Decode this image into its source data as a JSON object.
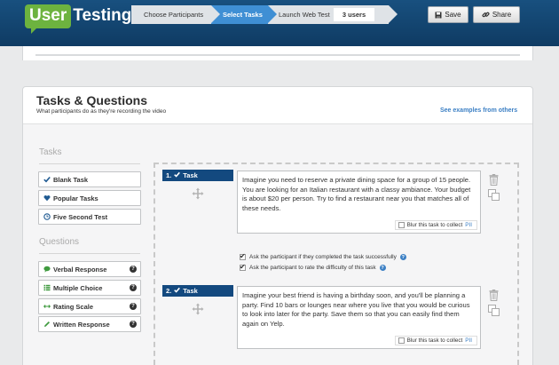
{
  "header": {
    "logo_user": "User",
    "logo_testing": "Testing",
    "logo_reg": "®",
    "steps": [
      "Choose Participants",
      "Select Tasks",
      "Launch Web Test"
    ],
    "active_step": "Select Tasks",
    "users_count": "3 users",
    "save_label": "Save",
    "share_label": "Share"
  },
  "card": {
    "title": "Tasks & Questions",
    "subtitle": "What participants do as they're recording the video",
    "examples_link": "See examples from others"
  },
  "sidebar": {
    "tasks_title": "Tasks",
    "task_items": [
      {
        "label": "Blank Task",
        "icon": "checkmark-icon"
      },
      {
        "label": "Popular Tasks",
        "icon": "heart-icon"
      },
      {
        "label": "Five Second Test",
        "icon": "clock-icon"
      }
    ],
    "questions_title": "Questions",
    "question_items": [
      {
        "label": "Verbal Response",
        "icon": "speech-bubble-icon"
      },
      {
        "label": "Multiple Choice",
        "icon": "list-icon"
      },
      {
        "label": "Rating Scale",
        "icon": "double-arrow-icon"
      },
      {
        "label": "Written Response",
        "icon": "pencil-icon"
      }
    ]
  },
  "tasks": [
    {
      "number": "1.",
      "type": "Task",
      "text": "Imagine you need to reserve a private dining space for a group of 15 people. You are looking for an Italian restaurant with a classy ambiance. Your budget is about $20 per person. Try to find a restaurant near you that matches all of these needs.",
      "blur_label": "Blur this task to collect",
      "blur_link": "PII"
    },
    {
      "number": "2.",
      "type": "Task",
      "text": "Imagine your best friend is having a birthday soon, and you'll be planning a party. Find 10 bars or lounges near where you live that you would be curious to look into later for the party. Save them so that you can easily find them again on Yelp.",
      "blur_label": "Blur this task to collect",
      "blur_link": "PII"
    }
  ],
  "options": [
    {
      "label": "Ask the participant if they completed the task successfully",
      "checked": true
    },
    {
      "label": "Ask the participant to rate the difficulty of this task",
      "checked": true
    }
  ],
  "colors": {
    "header_bg": "#13497f",
    "active_step": "#3f8fd4",
    "logo_green": "#6db33f",
    "link_blue": "#3b7fc4"
  }
}
